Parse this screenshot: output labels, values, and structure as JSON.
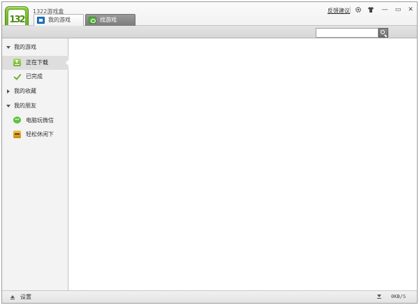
{
  "app": {
    "title": "1322游戏盒",
    "logo_text": "132",
    "feedback_link": "反馈建议"
  },
  "window_controls": {
    "settings_icon": "gear-icon",
    "skin_icon": "shirt-icon",
    "minimize": "—",
    "maximize": "▭",
    "close": "✕"
  },
  "tabs": [
    {
      "label": "我的游戏",
      "icon": "my-games-icon",
      "active": true
    },
    {
      "label": "找游戏",
      "icon": "find-games-icon",
      "active": false
    }
  ],
  "search": {
    "placeholder": "",
    "value": ""
  },
  "sidebar": {
    "groups": [
      {
        "label": "我的游戏",
        "expanded": true,
        "items": [
          {
            "label": "正在下载",
            "icon": "download-icon",
            "active": true
          },
          {
            "label": "已完成",
            "icon": "checkmark-icon",
            "active": false
          }
        ]
      },
      {
        "label": "我的收藏",
        "expanded": false,
        "items": []
      },
      {
        "label": "我的朋友",
        "expanded": true,
        "items": [
          {
            "label": "电脑玩微信",
            "icon": "wechat-icon",
            "active": false
          },
          {
            "label": "轻松休闲下",
            "icon": "casual-game-icon",
            "active": false
          }
        ]
      }
    ]
  },
  "statusbar": {
    "settings_label": "设置",
    "speed": "0KB/S"
  },
  "colors": {
    "accent_green": "#6fb02e",
    "tab_active_bg": "#ffffff",
    "tab_inactive_bg": "#8a8a8a",
    "sidebar_bg": "#f3f3f3",
    "sidebar_active_bg": "#dedede"
  }
}
